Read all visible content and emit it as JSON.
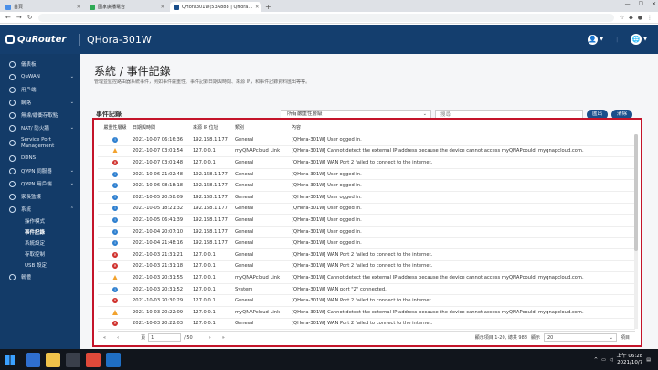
{
  "browser": {
    "tabs": [
      {
        "label": "首頁"
      },
      {
        "label": "國家廣播電台"
      },
      {
        "label": "QHora301W(53A888 | QHora..."
      }
    ],
    "active_tab": 2,
    "url": "",
    "new_tab_glyph": "+"
  },
  "header": {
    "brand": "QuRouter",
    "model": "QHora-301W",
    "avatar_glyph": "👤",
    "lang_glyph": "🌐"
  },
  "sidebar": {
    "items": [
      {
        "label": "儀表板",
        "icon": "dashboard-icon"
      },
      {
        "label": "QuWAN",
        "icon": "quwan-icon",
        "chevron": "⌄"
      },
      {
        "label": "用戶端",
        "icon": "clients-icon"
      },
      {
        "label": "網路",
        "icon": "network-icon",
        "chevron": "⌄"
      },
      {
        "label": "無線/緩衝存取點",
        "icon": "wireless-icon"
      },
      {
        "label": "NAT/ 防火牆",
        "icon": "firewall-icon",
        "chevron": "⌄"
      },
      {
        "label": "Service Port Management",
        "icon": "service-port-icon"
      },
      {
        "label": "DDNS",
        "icon": "ddns-icon"
      },
      {
        "label": "QVPN 伺服器",
        "icon": "vpn-server-icon",
        "chevron": "⌄"
      },
      {
        "label": "QVPN 用戶端",
        "icon": "vpn-client-icon",
        "chevron": "⌄"
      },
      {
        "label": "家長監護",
        "icon": "parental-icon"
      },
      {
        "label": "系統",
        "icon": "system-icon",
        "chevron": "⌃"
      }
    ],
    "sub_items": [
      {
        "label": "操作模式"
      },
      {
        "label": "事件記錄"
      },
      {
        "label": "系統設定"
      },
      {
        "label": "存取控制"
      },
      {
        "label": "USB 設定"
      }
    ],
    "active_sub": 1,
    "footer_item": {
      "label": "韌體",
      "icon": "firmware-icon"
    }
  },
  "page": {
    "title": "系統 / 事件記錄",
    "description": "管理並監控路由器系統事件，例如事件嚴重性、事件記錄日期與時間、來源 IP，和事件記錄資料匯出等等。"
  },
  "toolbar": {
    "title": "事件記錄",
    "severity_select": "所有嚴重性層級",
    "search_placeholder": "搜尋",
    "export_label": "匯出",
    "clear_label": "清除"
  },
  "table": {
    "headers": [
      "嚴重性層級",
      "日期與時間",
      "來源 IP 位址",
      "類別",
      "內容"
    ],
    "rows": [
      {
        "severity": "info",
        "datetime": "2021-10-07 06:16:36",
        "ip": "192.168.1.177",
        "category": "General",
        "content": "[QHora-301W] User                    ogged in."
      },
      {
        "severity": "warning",
        "datetime": "2021-10-07 03:01:54",
        "ip": "127.0.0.1",
        "category": "myQNAPcloud Link",
        "content": "[QHora-301W] Cannot detect the external IP address because the device cannot access myQNAPcould: myqnapcloud.com."
      },
      {
        "severity": "error",
        "datetime": "2021-10-07 03:01:48",
        "ip": "127.0.0.1",
        "category": "General",
        "content": "[QHora-301W] WAN Port 2 failed to connect to the internet."
      },
      {
        "severity": "info",
        "datetime": "2021-10-06 21:02:48",
        "ip": "192.168.1.177",
        "category": "General",
        "content": "[QHora-301W] User                    ogged in."
      },
      {
        "severity": "info",
        "datetime": "2021-10-06 08:18:18",
        "ip": "192.168.1.177",
        "category": "General",
        "content": "[QHora-301W] User                    ogged in."
      },
      {
        "severity": "info",
        "datetime": "2021-10-05 20:58:09",
        "ip": "192.168.1.177",
        "category": "General",
        "content": "[QHora-301W] User                    ogged in."
      },
      {
        "severity": "info",
        "datetime": "2021-10-05 18:21:32",
        "ip": "192.168.1.177",
        "category": "General",
        "content": "[QHora-301W] User                    ogged in."
      },
      {
        "severity": "info",
        "datetime": "2021-10-05 06:41:39",
        "ip": "192.168.1.177",
        "category": "General",
        "content": "[QHora-301W] User                    ogged in."
      },
      {
        "severity": "info",
        "datetime": "2021-10-04 20:07:10",
        "ip": "192.168.1.177",
        "category": "General",
        "content": "[QHora-301W] User                    ogged in."
      },
      {
        "severity": "info",
        "datetime": "2021-10-04 21:48:16",
        "ip": "192.168.1.177",
        "category": "General",
        "content": "[QHora-301W] User                    ogged in."
      },
      {
        "severity": "error",
        "datetime": "2021-10-03 21:31:21",
        "ip": "127.0.0.1",
        "category": "General",
        "content": "[QHora-301W] WAN Port 2 failed to connect to the internet."
      },
      {
        "severity": "error",
        "datetime": "2021-10-03 21:31:18",
        "ip": "127.0.0.1",
        "category": "General",
        "content": "[QHora-301W] WAN Port 2 failed to connect to the internet."
      },
      {
        "severity": "warning",
        "datetime": "2021-10-03 20:31:55",
        "ip": "127.0.0.1",
        "category": "myQNAPcloud Link",
        "content": "[QHora-301W] Cannot detect the external IP address because the device cannot access myQNAPcould: myqnapcloud.com."
      },
      {
        "severity": "info",
        "datetime": "2021-10-03 20:31:52",
        "ip": "127.0.0.1",
        "category": "System",
        "content": "[QHora-301W] WAN port \"2\" connected."
      },
      {
        "severity": "error",
        "datetime": "2021-10-03 20:30:29",
        "ip": "127.0.0.1",
        "category": "General",
        "content": "[QHora-301W] WAN Port 2 failed to connect to the internet."
      },
      {
        "severity": "warning",
        "datetime": "2021-10-03 20:22:09",
        "ip": "127.0.0.1",
        "category": "myQNAPcloud Link",
        "content": "[QHora-301W] Cannot detect the external IP address because the device cannot access myQNAPcould: myqnapcloud.com."
      },
      {
        "severity": "error",
        "datetime": "2021-10-03 20:22:03",
        "ip": "127.0.0.1",
        "category": "General",
        "content": "[QHora-301W] WAN Port 2 failed to connect to the internet."
      }
    ]
  },
  "pager": {
    "first_glyph": "«",
    "prev_glyph": "‹",
    "page_label": "頁",
    "page_value": "1",
    "total_pages": "/ 50",
    "next_glyph": "›",
    "last_glyph": "»",
    "summary": "顯示項目 1-20, 總共 988",
    "per_page_label": "顯示",
    "per_page_value": "20",
    "per_page_unit": "項目"
  },
  "taskbar": {
    "time": "上午 06:28",
    "date": "2021/10/7"
  },
  "colors": {
    "header_bg": "#143e6e",
    "sidebar_bg": "#133b68",
    "highlight_border": "#c4142a",
    "button_bg": "#1a4f8b"
  }
}
